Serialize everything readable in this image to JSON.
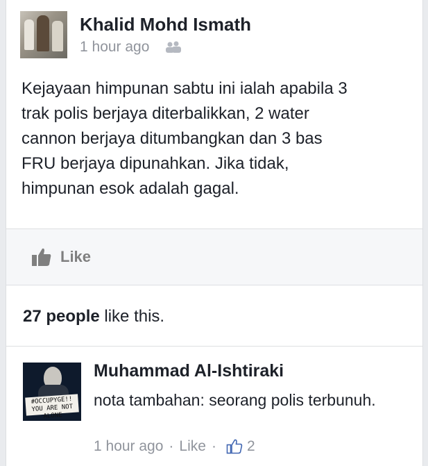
{
  "post": {
    "author": "Khalid Mohd Ismath",
    "timestamp": "1 hour ago",
    "audience_icon": "friends-icon",
    "text": "Kejayaan himpunan sabtu ini ialah apabila 3\ntrak polis berjaya diterbalikkan, 2 water\ncannon berjaya ditumbangkan dan 3 bas\nFRU berjaya dipunahkan. Jika tidak,\nhimpunan esok adalah gagal."
  },
  "actions": {
    "like_label": "Like",
    "like_icon": "thumbs-up-icon"
  },
  "likes": {
    "count_text": "27 people",
    "suffix": " like this."
  },
  "comment": {
    "author": "Muhammad Al-Ishtiraki",
    "text": "nota tambahan: seorang polis terbunuh.",
    "timestamp": "1 hour ago",
    "separator": "·",
    "like_label": "Like",
    "like_count": "2",
    "avatar_banner": "#OCCUPYGE!! YOU ARE NOT ALONE"
  },
  "colors": {
    "text": "#1d2129",
    "muted": "#90949c",
    "action_bar": "#f6f7f9",
    "like_button": "#7f7f7f"
  }
}
